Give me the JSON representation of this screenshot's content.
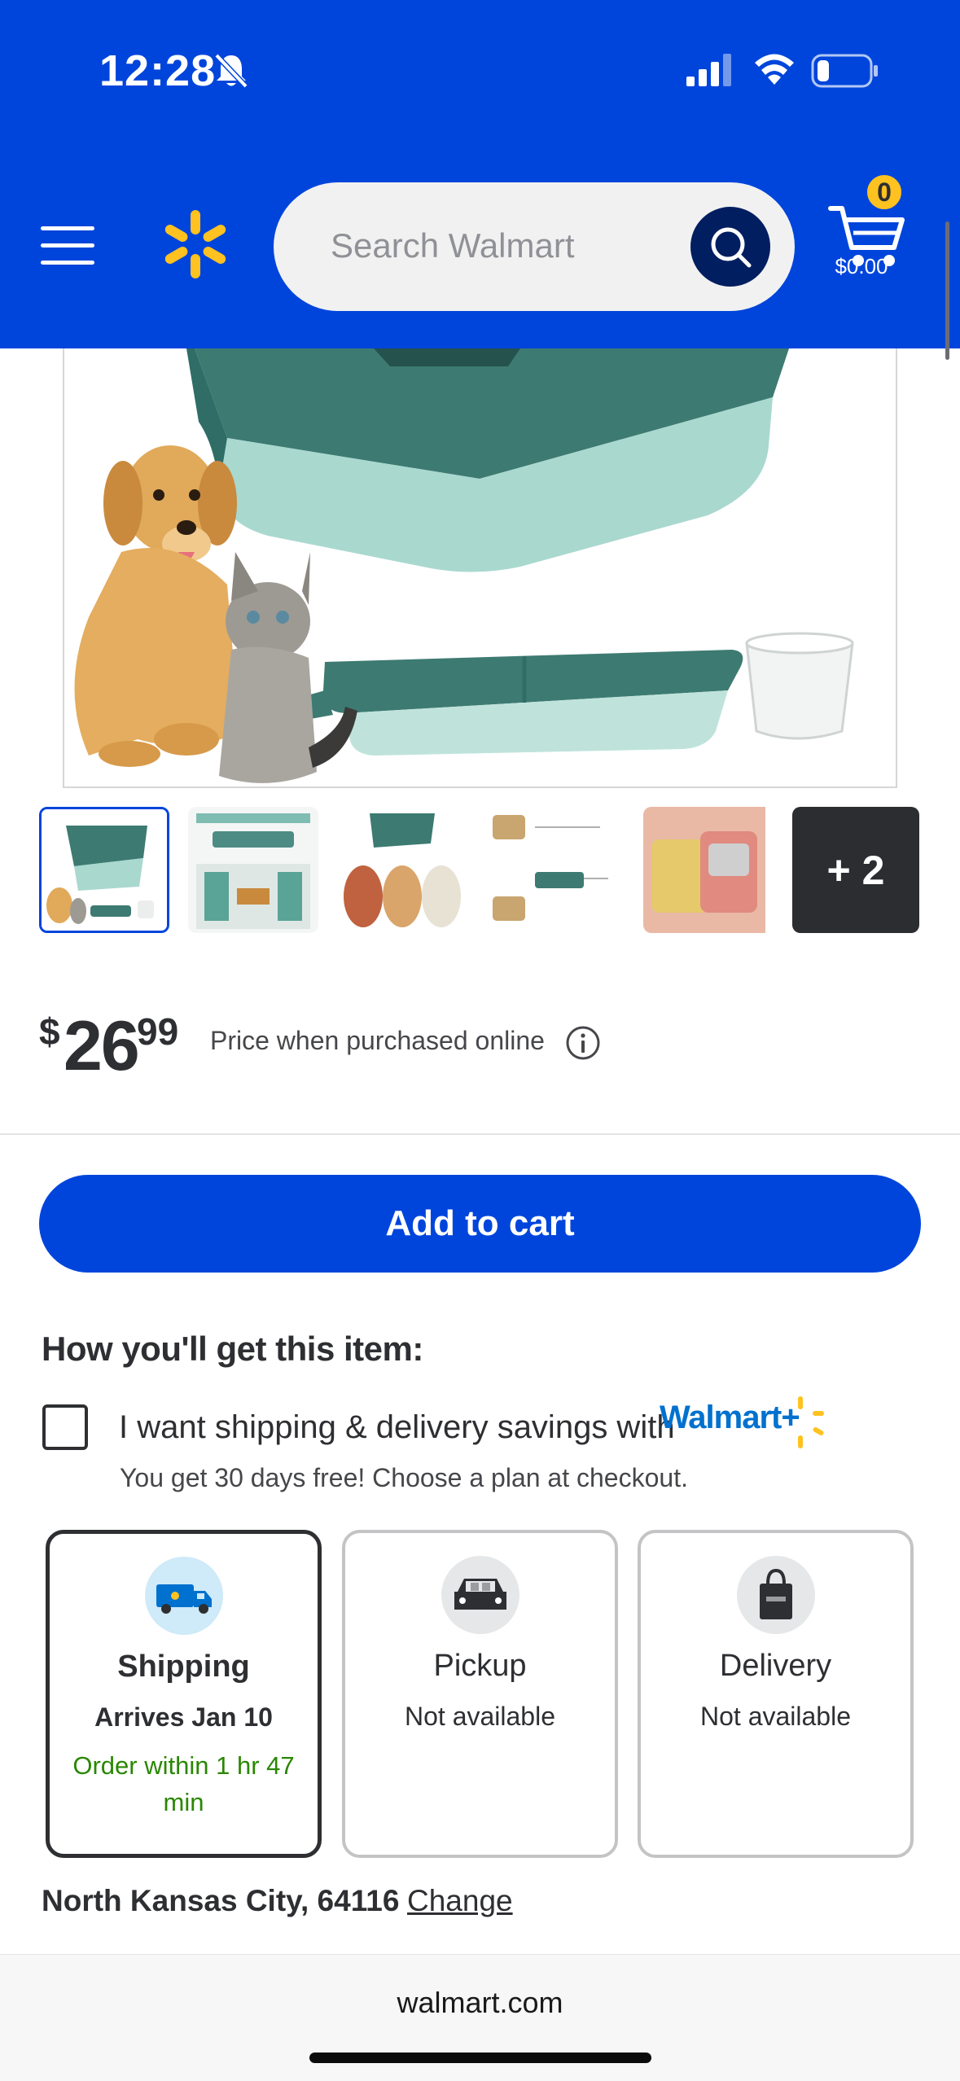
{
  "status_bar": {
    "time": "12:28"
  },
  "header": {
    "search_placeholder": "Search Walmart",
    "cart_count": "0",
    "cart_total": "$0.00"
  },
  "product": {
    "thumbnail_more": "+ 2",
    "price": {
      "currency": "$",
      "dollars": "26",
      "cents": "99"
    },
    "price_note": "Price when purchased online"
  },
  "add_to_cart_label": "Add to cart",
  "fulfillment": {
    "title": "How you'll get this item:",
    "plus_offer": "I want shipping & delivery savings with",
    "plus_brand": "Walmart+",
    "plus_sub": "You get 30 days free! Choose a plan at checkout.",
    "options": [
      {
        "title": "Shipping",
        "subtitle": "Arrives Jan 10",
        "note": "Order within 1 hr 47 min"
      },
      {
        "title": "Pickup",
        "subtitle": "Not available"
      },
      {
        "title": "Delivery",
        "subtitle": "Not available"
      }
    ],
    "location": "North Kansas City, 64116",
    "change_label": "Change"
  },
  "browser": {
    "url": "walmart.com"
  },
  "colors": {
    "brand_blue": "#0045db",
    "spark_yellow": "#ffc220",
    "success_green": "#2a8703",
    "dark_navy": "#001e60"
  }
}
